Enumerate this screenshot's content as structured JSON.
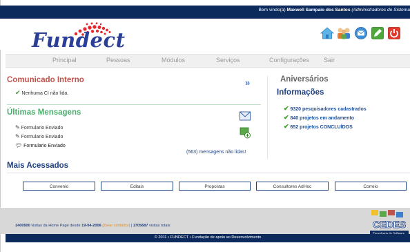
{
  "topbar": {
    "welcome_prefix": "Bem vindo(a)",
    "user_name": "Maxwell Sampaio dos Santos",
    "user_role": "(Administradores do Sistema"
  },
  "logo": {
    "text": "Fundect"
  },
  "header_icons": [
    "home-icon",
    "people-icon",
    "mail-icon",
    "edit-icon",
    "power-icon"
  ],
  "nav": {
    "items": [
      "Principal",
      "Pessoas",
      "Módulos",
      "Serviços",
      "Configurações",
      "Sair"
    ]
  },
  "comunicado": {
    "title": "Comunicado Interno",
    "status": "Nenhuma CI não lida."
  },
  "mensagens": {
    "title": "Últimas Mensagens",
    "items": [
      "Formulario Enviado",
      "Formulario Enviado",
      "Formulario Enviado"
    ],
    "unread": "(563) mensagens não lidas!"
  },
  "aniversarios": {
    "title": "Aniversários"
  },
  "informacoes": {
    "title": "Informações",
    "items": [
      "9320 pesquisadores cadastrados",
      "840 projetos em andamento",
      "652 projetos CONCLUÍDOS"
    ]
  },
  "mais_acessados": {
    "title": "Mais Acessados",
    "buttons": [
      "Convenio",
      "Editais",
      "Propostas",
      "Consultores AdHoc",
      "Correio"
    ]
  },
  "footer": {
    "visits_count": "1400500",
    "visits_text": "visitas da Home Page desde",
    "visits_since": "19-04-2006",
    "reset_link": "[Zerar contador]",
    "separator": "|",
    "total_count": "1705687",
    "total_text": "visitas totais",
    "copyright": "© 2011 • FUNDECT • Fundação de apoio ao Desenvolvimento",
    "cedes_logo_text": "CEDES",
    "cedes_caption": "Engenharia de Software"
  },
  "colors": {
    "navy": "#0d2a5c",
    "brand_blue": "#2b3f97",
    "comunicado_red": "#c0544d",
    "mensagens_green": "#4caf6e",
    "section_blue": "#1e3f82",
    "info_blue": "#1a4fa0",
    "check_green": "#3a9a2a"
  }
}
